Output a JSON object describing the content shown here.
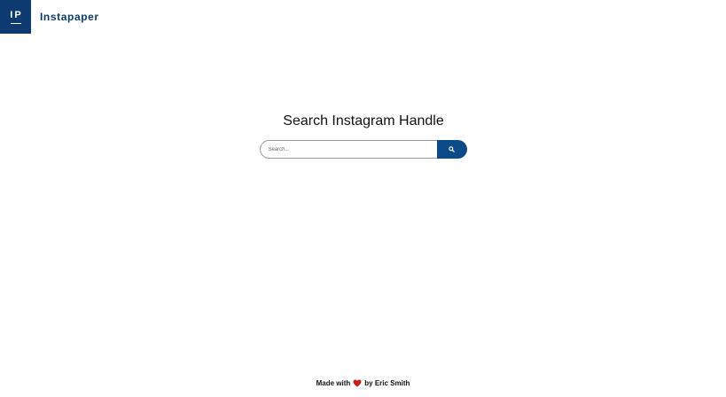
{
  "header": {
    "logo_text": "IP",
    "brand_name": "Instapaper"
  },
  "main": {
    "title": "Search Instagram Handle",
    "search": {
      "placeholder": "Search...",
      "value": "",
      "button_icon": "search-icon"
    }
  },
  "footer": {
    "made_with": "Made with",
    "heart_icon": "heart-icon",
    "by_author": "by Eric Smith"
  },
  "colors": {
    "brand": "#0d3a70",
    "button": "#0d4a8a",
    "heart": "#c81e1e"
  }
}
